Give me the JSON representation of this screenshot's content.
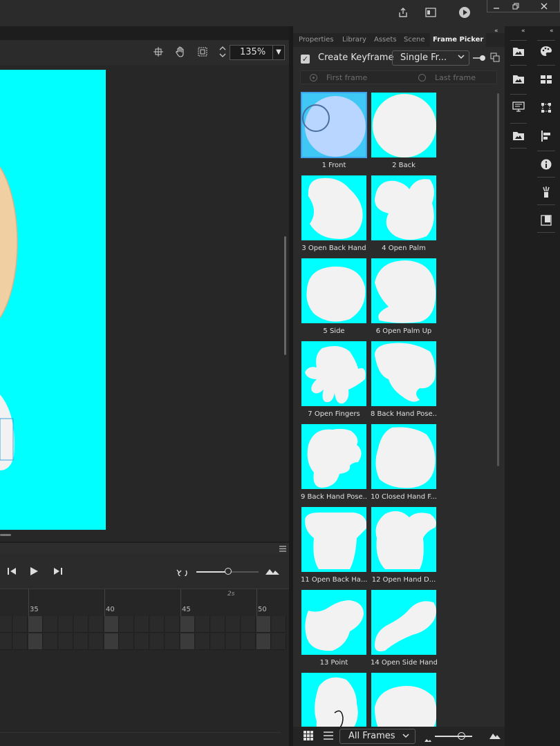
{
  "stage": {
    "zoom": "135%",
    "canvas_color": "#00ffff"
  },
  "timeline": {
    "ruler_numbers": [
      "35",
      "40",
      "45",
      "50"
    ],
    "time_marker": "2s"
  },
  "panel": {
    "tabs": [
      "Properties",
      "Library",
      "Assets",
      "Scene",
      "Frame Picker"
    ],
    "active_tab": "Frame Picker",
    "create_keyframe_label": "Create Keyframe",
    "create_keyframe_checked": true,
    "mode_select": "Single Fr...",
    "first_frame_label": "First frame",
    "last_frame_label": "Last frame",
    "frames": [
      {
        "label": "1 Front",
        "selected": true
      },
      {
        "label": "2 Back"
      },
      {
        "label": "3 Open Back Hand"
      },
      {
        "label": "4 Open Palm"
      },
      {
        "label": "5 Side"
      },
      {
        "label": "6 Open Palm Up"
      },
      {
        "label": "7 Open Fingers"
      },
      {
        "label": "8 Back Hand Pose..."
      },
      {
        "label": "9 Back Hand Pose..."
      },
      {
        "label": "10 Closed Hand F..."
      },
      {
        "label": "11 Open Back Ha..."
      },
      {
        "label": "12 Open Hand D..."
      },
      {
        "label": "13 Point"
      },
      {
        "label": "14 Open Side Hand"
      },
      {
        "label": ""
      },
      {
        "label": ""
      }
    ],
    "bottom_select": "All Frames"
  },
  "colors": {
    "accent": "#3ea0e8",
    "thumb_bg": "#00ffff",
    "hand_fill": "#f2f2f2"
  },
  "icons": {
    "titlebar": [
      "share-icon",
      "panel-layout-icon",
      "play-circle-icon"
    ],
    "window": [
      "minimize-icon",
      "restore-icon",
      "close-icon"
    ],
    "stage_toolbar": [
      "snap-center-icon",
      "hand-tool-icon",
      "clip-stage-icon",
      "zoom-stepper-icon"
    ],
    "dock1": [
      "library-folder-icon",
      "library-folder-icon-2",
      "screen-icon",
      "library-folder-icon-3"
    ],
    "dock2": [
      "color-palette-icon",
      "swatches-icon",
      "transform-icon",
      "align-icon",
      "info-icon",
      "motion-presets-icon",
      "assets-book-icon"
    ]
  }
}
